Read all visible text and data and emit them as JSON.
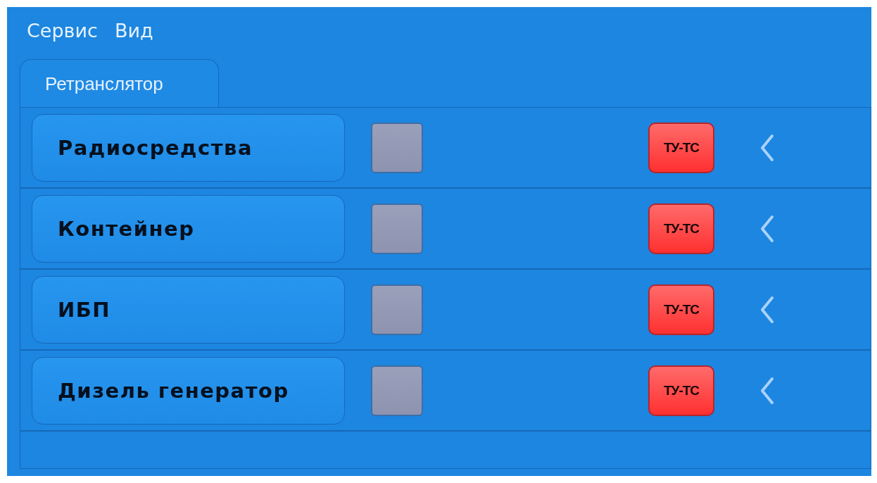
{
  "menu": [
    {
      "label": "Сервис"
    },
    {
      "label": "Вид"
    }
  ],
  "tabs": [
    {
      "label": "Ретранслятор",
      "selected": true
    }
  ],
  "rows": [
    {
      "name": "Радиосредства",
      "indicator_on": false,
      "badge": "ТУ-ТС"
    },
    {
      "name": "Контейнер",
      "indicator_on": false,
      "badge": "ТУ-ТС"
    },
    {
      "name": "ИБП",
      "indicator_on": false,
      "badge": "ТУ-ТС"
    },
    {
      "name": "Дизель генератор",
      "indicator_on": false,
      "badge": "ТУ-ТС"
    }
  ]
}
